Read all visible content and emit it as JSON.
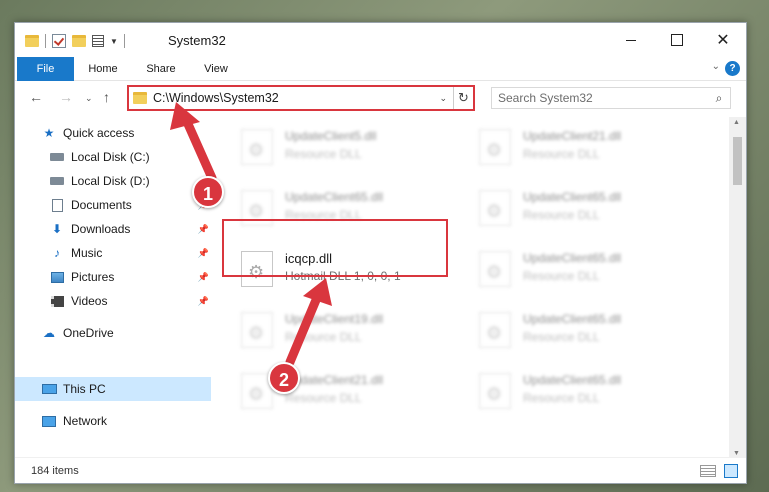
{
  "window": {
    "title": "System32"
  },
  "ribbon": {
    "file": "File",
    "home": "Home",
    "share": "Share",
    "view": "View",
    "help": "?"
  },
  "navbar": {
    "address": "C:\\Windows\\System32",
    "search_placeholder": "Search System32"
  },
  "sidebar": {
    "items": [
      {
        "label": "Quick access",
        "icon": "star-icon"
      },
      {
        "label": "Local Disk (C:)",
        "icon": "disk-icon"
      },
      {
        "label": "Local Disk (D:)",
        "icon": "disk-icon"
      },
      {
        "label": "Documents",
        "icon": "documents-icon"
      },
      {
        "label": "Downloads",
        "icon": "downloads-icon"
      },
      {
        "label": "Music",
        "icon": "music-icon"
      },
      {
        "label": "Pictures",
        "icon": "pictures-icon"
      },
      {
        "label": "Videos",
        "icon": "videos-icon"
      },
      {
        "label": "OneDrive",
        "icon": "cloud-icon"
      },
      {
        "label": "This PC",
        "icon": "pc-icon"
      },
      {
        "label": "Network",
        "icon": "network-icon"
      }
    ]
  },
  "files": [
    {
      "name": "UpdateClient5.dll",
      "desc": "Resource DLL"
    },
    {
      "name": "UpdateClient21.dll",
      "desc": "Resource DLL"
    },
    {
      "name": "UpdateClient65.dll",
      "desc": "Resource DLL"
    },
    {
      "name": "UpdateClient65.dll",
      "desc": "Resource DLL"
    },
    {
      "name": "icqcp.dll",
      "desc": "Hotmail DLL 1, 0, 0, 1"
    },
    {
      "name": "UpdateClient65.dll",
      "desc": "Resource DLL"
    },
    {
      "name": "UpdateClient19.dll",
      "desc": "Resource DLL"
    },
    {
      "name": "UpdateClient65.dll",
      "desc": "Resource DLL"
    },
    {
      "name": "UpdateClient21.dll",
      "desc": "Resource DLL"
    },
    {
      "name": "UpdateClient65.dll",
      "desc": "Resource DLL"
    }
  ],
  "status": {
    "count": "184 items"
  },
  "callouts": {
    "one": "1",
    "two": "2"
  },
  "colors": {
    "accent": "#1979ca",
    "highlight": "#d9363e",
    "selected": "#cce8ff"
  }
}
